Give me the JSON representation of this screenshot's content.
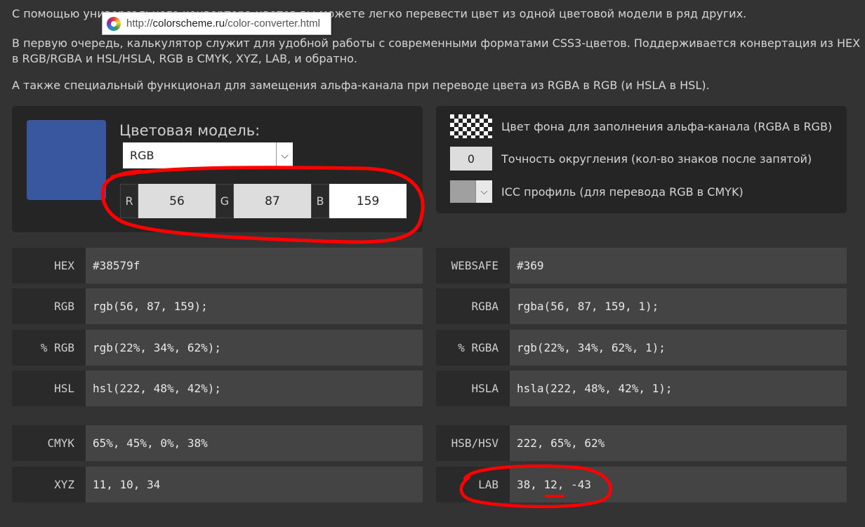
{
  "intro": {
    "p1": "С помощью универсального конвертера цветов вы можете легко перевести цвет из одной цветовой модели в ряд других.",
    "p2": "В первую очередь, калькулятор служит для удобной работы с современными форматами CSS3-цветов. Поддерживается конвертация из HEX в RGB/RGBA и HSL/HSLA, RGB в CMYK, XYZ, LAB, и обратно.",
    "p3": "А также специальный функционал для замещения альфа-канала при переводе цвета из RGBA в RGB (и HSLA в HSL)."
  },
  "tooltip": {
    "scheme": "http://",
    "host": "colorscheme.ru",
    "path": "/color-converter.html"
  },
  "converter": {
    "swatch_color": "#38579f",
    "model_label": "Цветовая модель:",
    "model_value": "RGB",
    "channels": [
      {
        "label": "R",
        "value": "56"
      },
      {
        "label": "G",
        "value": "87"
      },
      {
        "label": "B",
        "value": "159"
      }
    ]
  },
  "options": {
    "bg_fill_label": "Цвет фона для заполнения альфа-канала (RGBA в RGB)",
    "precision_value": "0",
    "precision_label": "Точность округления (кол-во знаков после запятой)",
    "icc_label": "ICC профиль (для перевода RGB в CMYK)"
  },
  "results": {
    "left": [
      {
        "key": "HEX",
        "value": "#38579f"
      },
      {
        "key": "RGB",
        "value": "rgb(56, 87, 159);"
      },
      {
        "key": "% RGB",
        "value": "rgb(22%, 34%, 62%);"
      },
      {
        "key": "HSL",
        "value": "hsl(222, 48%, 42%);"
      },
      {
        "key": "CMYK",
        "value": "65%, 45%, 0%, 38%"
      },
      {
        "key": "XYZ",
        "value": "11, 10, 34"
      }
    ],
    "right": [
      {
        "key": "WEBSAFE",
        "value": "#369"
      },
      {
        "key": "RGBA",
        "value": "rgba(56, 87, 159, 1);"
      },
      {
        "key": "% RGBA",
        "value": "rgb(22%, 34%, 62%, 1);"
      },
      {
        "key": "HSLA",
        "value": "hsla(222, 48%, 42%, 1);"
      },
      {
        "key": "HSB/HSV",
        "value": "222, 65%, 62%"
      },
      {
        "key": "LAB",
        "value": "38, 12, -43"
      }
    ]
  },
  "colors": {
    "page_bg": "#333333",
    "panel_bg": "#252525",
    "annotation": "#ff0000"
  }
}
